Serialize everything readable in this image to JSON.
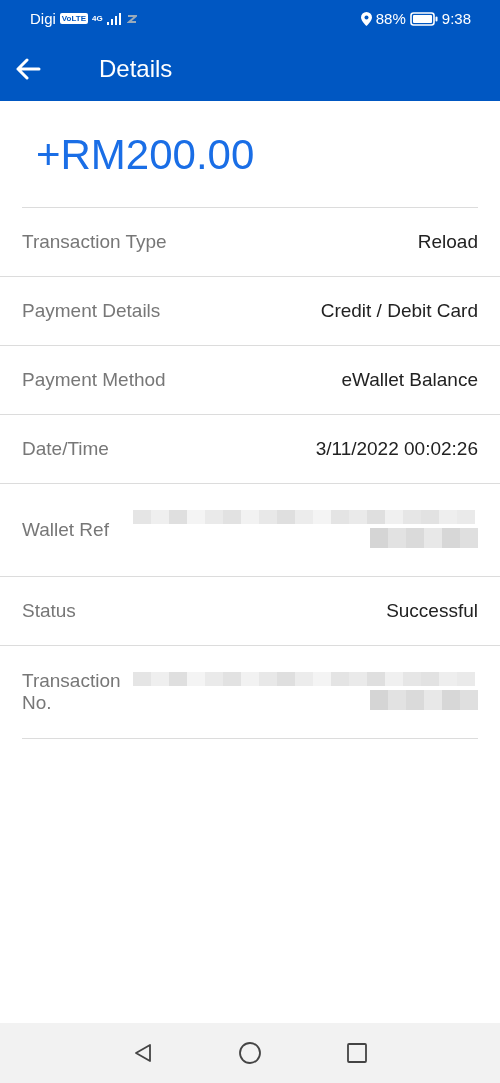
{
  "status_bar": {
    "carrier": "Digi",
    "network_badge": "VoLTE",
    "network_type": "4G",
    "battery": "88%",
    "time": "9:38"
  },
  "app_bar": {
    "title": "Details"
  },
  "amount": "+RM200.00",
  "rows": [
    {
      "kind": "text",
      "label": "Transaction Type",
      "value": "Reload"
    },
    {
      "kind": "text",
      "label": "Payment Details",
      "value": "Credit / Debit Card"
    },
    {
      "kind": "text",
      "label": "Payment Method",
      "value": "eWallet Balance"
    },
    {
      "kind": "text",
      "label": "Date/Time",
      "value": "3/11/2022 00:02:26"
    },
    {
      "kind": "redacted",
      "label": "Wallet Ref"
    },
    {
      "kind": "text",
      "label": "Status",
      "value": "Successful"
    },
    {
      "kind": "redacted",
      "label": "Transaction No."
    }
  ]
}
